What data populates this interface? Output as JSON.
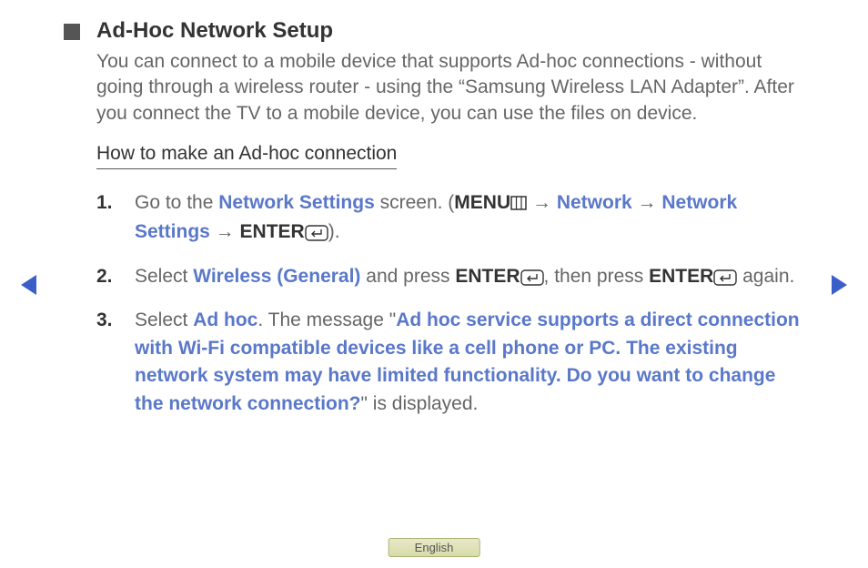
{
  "heading": "Ad-Hoc Network Setup",
  "intro": "You can connect to a mobile device that supports Ad-hoc connections - without going through a wireless router - using the “Samsung Wireless LAN Adapter”. After you connect the TV to a mobile device, you can use the files on device.",
  "subheading": "How to make an Ad-hoc connection",
  "steps": {
    "s1": {
      "num": "1.",
      "t1": "Go to the ",
      "link1": "Network Settings",
      "t2": " screen. (",
      "menu": "MENU",
      "arrow1": " → ",
      "link2": "Network",
      "arrow2": " → ",
      "link3": "Network Settings",
      "arrow3": " → ",
      "enter": "ENTER",
      "t3": ")."
    },
    "s2": {
      "num": "2.",
      "t1": "Select ",
      "link1": "Wireless (General)",
      "t2": " and press ",
      "enter1": "ENTER",
      "t3": ", then press ",
      "enter2": "ENTER",
      "t4": " again."
    },
    "s3": {
      "num": "3.",
      "t1": "Select ",
      "link1": "Ad hoc",
      "t2": ". The message \"",
      "msg": "Ad hoc service supports a direct connection with Wi-Fi compatible devices like a cell phone or PC. The existing network system may have limited functionality. Do you want to change the network connection?",
      "t3": "\" is displayed."
    }
  },
  "language": "English"
}
